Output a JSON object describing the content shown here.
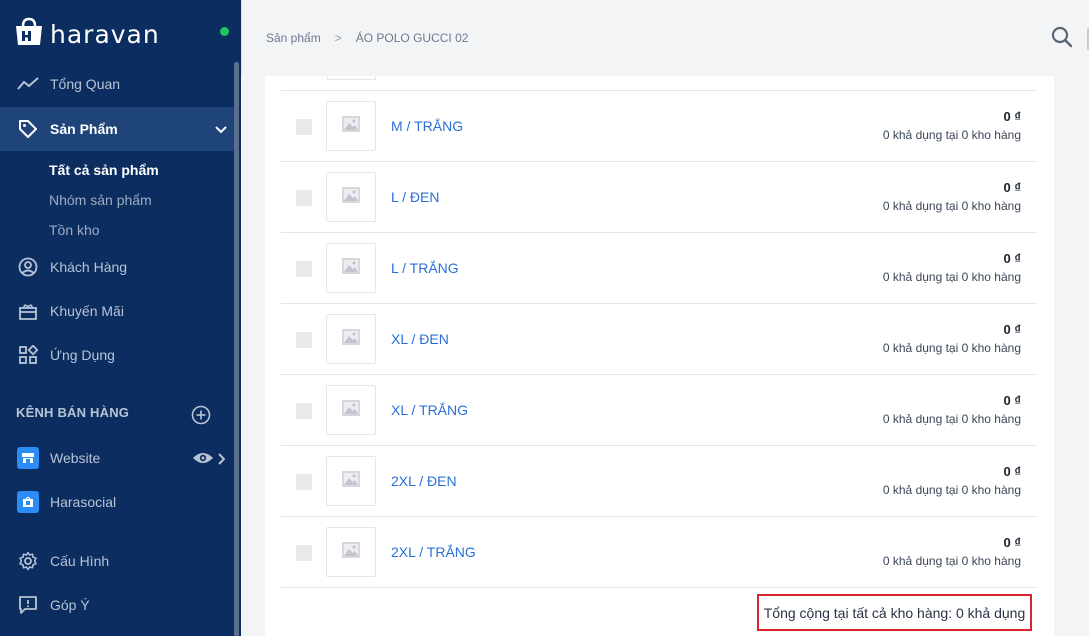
{
  "brand": {
    "name": "haravan",
    "status_color": "#1ec95b"
  },
  "sidebar": {
    "nav": [
      {
        "label": "Tổng Quan",
        "icon": "trend-line-icon"
      },
      {
        "label": "Sản Phẩm",
        "icon": "tag-icon",
        "active": true
      },
      {
        "label": "Khách Hàng",
        "icon": "user-circle-icon"
      },
      {
        "label": "Khuyến Mãi",
        "icon": "gift-icon"
      },
      {
        "label": "Ứng Dụng",
        "icon": "apps-grid-icon"
      }
    ],
    "sub_items": [
      {
        "label": "Tất cả sản phẩm",
        "active": true
      },
      {
        "label": "Nhóm sản phẩm"
      },
      {
        "label": "Tồn kho"
      }
    ],
    "channels_title": "KÊNH BÁN HÀNG",
    "channels": [
      {
        "label": "Website",
        "icon": "storefront-icon"
      },
      {
        "label": "Harasocial",
        "icon": "social-shop-icon"
      }
    ],
    "bottom": [
      {
        "label": "Cấu Hình",
        "icon": "gear-icon"
      },
      {
        "label": "Góp Ý",
        "icon": "feedback-icon"
      }
    ]
  },
  "breadcrumb": {
    "parent": "Sản phẩm",
    "separator": ">",
    "current": "ÁO POLO GUCCI 02"
  },
  "variants": [
    {
      "name": "M / TRẮNG",
      "price": "0 ₫",
      "stock": "0 khả dụng tại 0 kho hàng"
    },
    {
      "name": "L / ĐEN",
      "price": "0 ₫",
      "stock": "0 khả dụng tại 0 kho hàng"
    },
    {
      "name": "L / TRẮNG",
      "price": "0 ₫",
      "stock": "0 khả dụng tại 0 kho hàng"
    },
    {
      "name": "XL / ĐEN",
      "price": "0 ₫",
      "stock": "0 khả dụng tại 0 kho hàng"
    },
    {
      "name": "XL / TRẮNG",
      "price": "0 ₫",
      "stock": "0 khả dụng tại 0 kho hàng"
    },
    {
      "name": "2XL / ĐEN",
      "price": "0 ₫",
      "stock": "0 khả dụng tại 0 kho hàng"
    },
    {
      "name": "2XL / TRẮNG",
      "price": "0 ₫",
      "stock": "0 khả dụng tại 0 kho hàng"
    }
  ],
  "total": "Tổng cộng tại tất cả kho hàng: 0 khả dụng",
  "colors": {
    "sidebar_bg": "#0c2d5f",
    "active_bg": "#1f447a",
    "link": "#2a6fd8",
    "highlight_border": "#d9262c"
  }
}
